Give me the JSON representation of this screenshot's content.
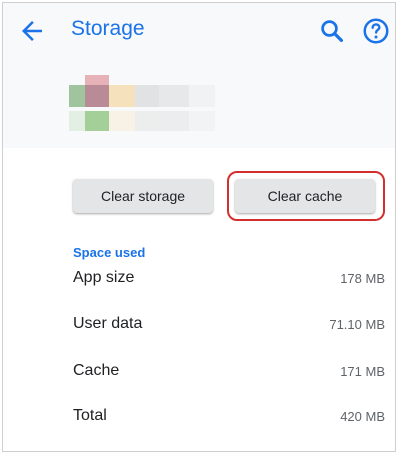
{
  "header": {
    "title": "Storage",
    "back_icon": "arrow-back-icon",
    "search_icon": "search-icon",
    "help_icon": "help-circle-icon"
  },
  "app_icon": {
    "description_icon": "blurred-app-icon"
  },
  "buttons": {
    "clear_storage": "Clear storage",
    "clear_cache": "Clear cache"
  },
  "section": {
    "title": "Space used"
  },
  "rows": [
    {
      "label": "App size",
      "value": "178 MB"
    },
    {
      "label": "User data",
      "value": "71.10 MB"
    },
    {
      "label": "Cache",
      "value": "171 MB"
    },
    {
      "label": "Total",
      "value": "420 MB"
    }
  ],
  "colors": {
    "accent": "#1a73e8",
    "highlight": "#d32f2f"
  }
}
